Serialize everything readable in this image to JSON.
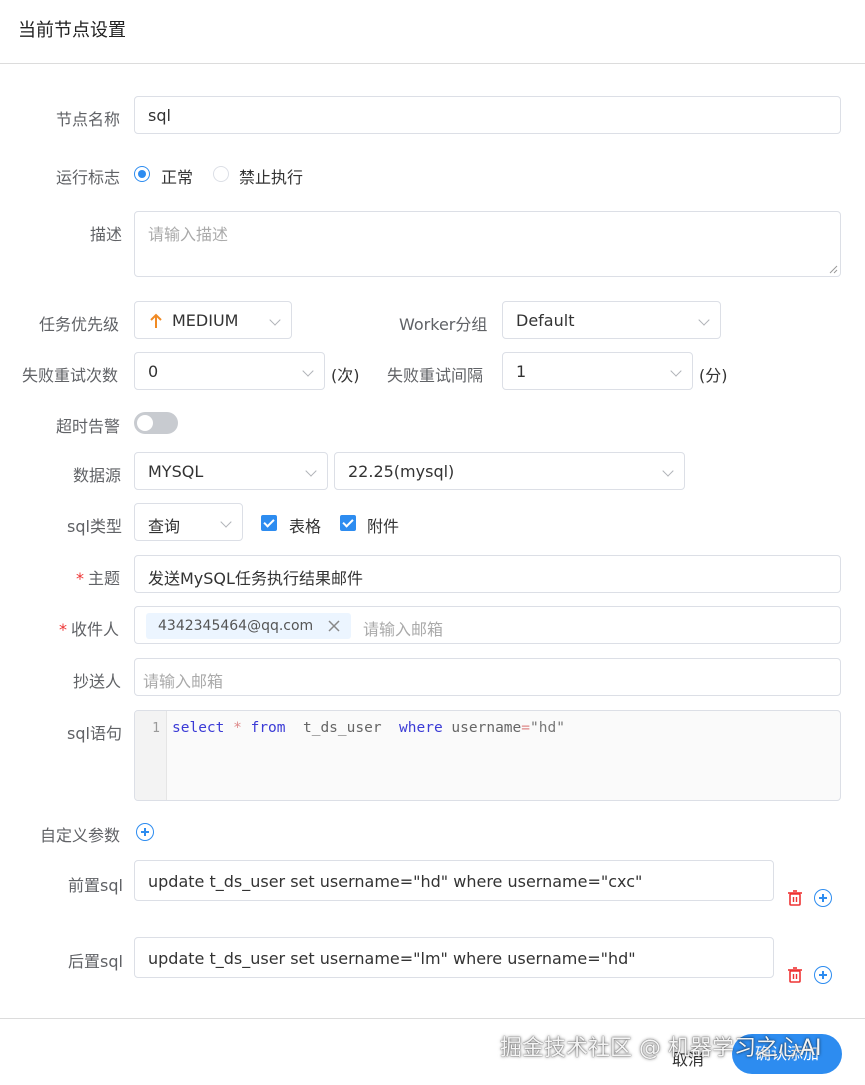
{
  "header": {
    "title": "当前节点设置"
  },
  "form": {
    "node_name": {
      "label": "节点名称",
      "value": "sql"
    },
    "run_flag": {
      "label": "运行标志",
      "options": [
        "正常",
        "禁止执行"
      ],
      "selected": "正常"
    },
    "description": {
      "label": "描述",
      "placeholder": "请输入描述"
    },
    "priority": {
      "label": "任务优先级",
      "value": "MEDIUM"
    },
    "worker_group": {
      "label": "Worker分组",
      "value": "Default"
    },
    "retry_times": {
      "label": "失败重试次数",
      "value": "0",
      "suffix": "(次)"
    },
    "retry_interval": {
      "label": "失败重试间隔",
      "value": "1",
      "suffix": "(分)"
    },
    "timeout_alarm": {
      "label": "超时告警",
      "enabled": false
    },
    "datasource": {
      "label": "数据源",
      "type": "MYSQL",
      "instance": "22.25(mysql)"
    },
    "sql_type": {
      "label": "sql类型",
      "value": "查询",
      "checkboxes": [
        {
          "label": "表格",
          "checked": true
        },
        {
          "label": "附件",
          "checked": true
        }
      ]
    },
    "subject": {
      "label": "主题",
      "required_mark": "*",
      "value": "发送MySQL任务执行结果邮件"
    },
    "recipients": {
      "label": "收件人",
      "required_mark": "*",
      "tags": [
        "4342345464@qq.com"
      ],
      "placeholder": "请输入邮箱"
    },
    "cc": {
      "label": "抄送人",
      "placeholder": "请输入邮箱"
    },
    "sql_statement": {
      "label": "sql语句",
      "line_number": "1",
      "tokens": [
        "select",
        "*",
        "from",
        "t_ds_user",
        "where",
        "username",
        "=",
        "\"hd\""
      ]
    },
    "custom_params": {
      "label": "自定义参数"
    },
    "pre_sql": {
      "label": "前置sql",
      "value": "update t_ds_user set username=\"hd\"  where username=\"cxc\""
    },
    "post_sql": {
      "label": "后置sql",
      "value": "update t_ds_user set username=\"lm\"  where username=\"hd\""
    }
  },
  "footer": {
    "cancel_label": "取消",
    "confirm_label": "确认添加"
  },
  "watermark": "掘金技术社区 @ 机器学习之心AI",
  "colors": {
    "primary": "#2d8cf0",
    "danger": "#e33",
    "border": "#dcdfe6",
    "priority_arrow": "#f08a24"
  }
}
